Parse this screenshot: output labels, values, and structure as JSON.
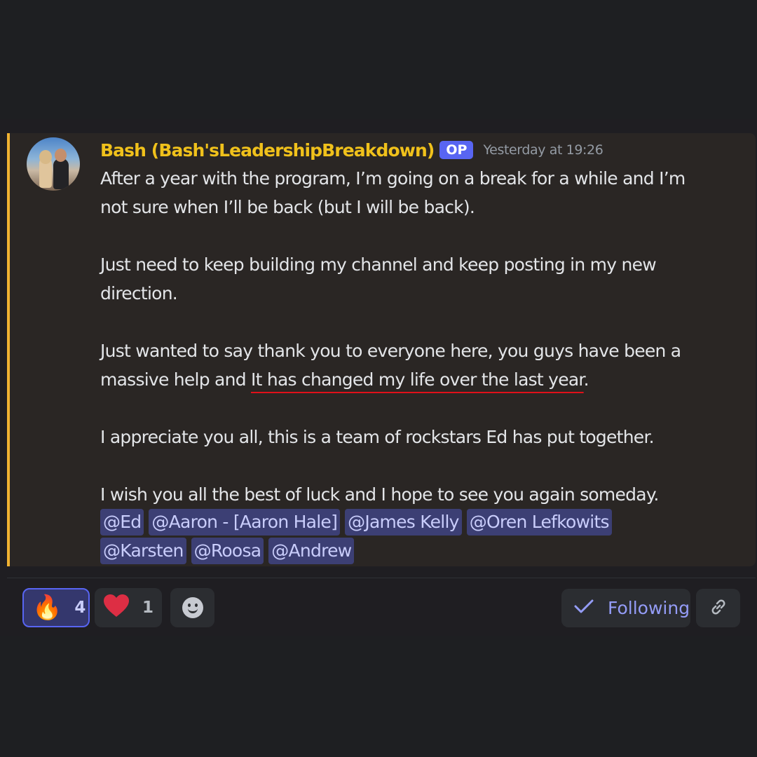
{
  "message": {
    "author": "Bash (Bash'sLeadershipBreakdown)",
    "badge": "OP",
    "timestamp": "Yesterday at 19:26",
    "paragraphs": {
      "p1_line1": "After a year with the program, I’m going on a break for a while and I’m",
      "p1_line2": "not sure when I’ll be back (but I will be back).",
      "p2_line1": "Just need to keep building my channel and keep posting in my new",
      "p2_line2": "direction.",
      "p3_line1": "Just wanted to say thank you to everyone here, you guys have been a",
      "p3_line2_start": "massive help and ",
      "p3_line2_highlight": "It has changed my life over the last year",
      "p3_line2_end": ".",
      "p4": "I appreciate you all, this is a team of rockstars Ed has put together.",
      "p5": "I wish you all the best of luck and I hope to see you again someday."
    },
    "mentions": [
      "@Ed",
      "@Aaron - [Aaron Hale]",
      "@James Kelly",
      "@Oren Lefkowits",
      "@Karsten",
      "@Roosa",
      "@Andrew"
    ],
    "highlight_color": "#e0101a",
    "accent_color": "#f0b232"
  },
  "reactions": [
    {
      "emoji": "🔥",
      "icon": "fire-icon",
      "count": "4"
    },
    {
      "emoji": "❤️",
      "icon": "heart-icon",
      "count": "1"
    }
  ],
  "actions": {
    "add_reaction_icon": "smiley-add-reaction-icon",
    "following_label": "Following",
    "following_icon": "checkmark-icon",
    "link_icon": "link-icon"
  }
}
